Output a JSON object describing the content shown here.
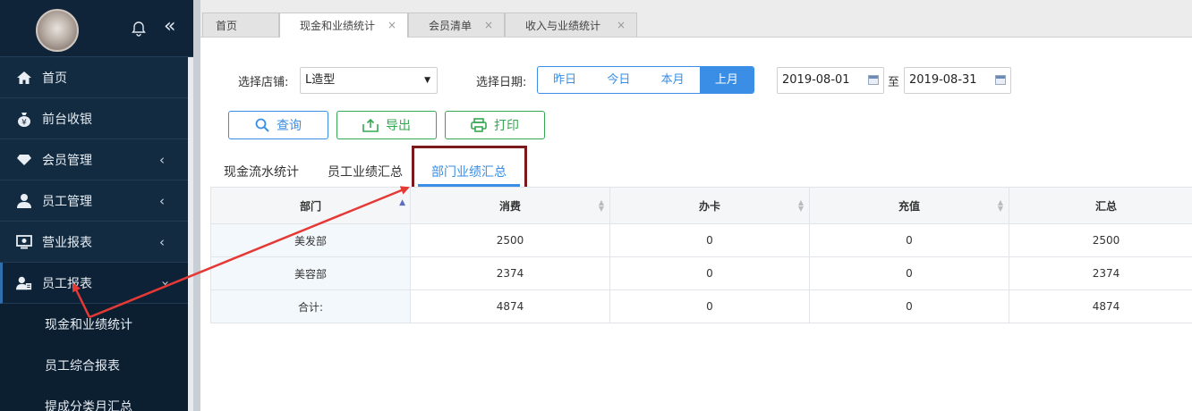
{
  "sidebar": {
    "menu": [
      {
        "label": "首页",
        "icon": "home-icon"
      },
      {
        "label": "前台收银",
        "icon": "money-bag-icon"
      },
      {
        "label": "会员管理",
        "icon": "diamond-icon"
      },
      {
        "label": "员工管理",
        "icon": "user-icon"
      },
      {
        "label": "营业报表",
        "icon": "monitor-icon"
      },
      {
        "label": "员工报表",
        "icon": "user-report-icon"
      }
    ],
    "submenu": [
      "现金和业绩统计",
      "员工综合报表",
      "提成分类月汇总"
    ]
  },
  "tabs": [
    {
      "label": "首页"
    },
    {
      "label": "现金和业绩统计",
      "close": "×"
    },
    {
      "label": "会员清单",
      "close": "×"
    },
    {
      "label": "收入与业绩统计",
      "close": "×"
    }
  ],
  "filters": {
    "store_label": "选择店铺:",
    "store_value": "L造型",
    "date_label": "选择日期:",
    "quick_dates": [
      "昨日",
      "今日",
      "本月",
      "上月"
    ],
    "selected_quick": "上月",
    "start_date": "2019-08-01",
    "to_label": "至",
    "end_date": "2019-08-31"
  },
  "actions": {
    "query": "查询",
    "export": "导出",
    "print": "打印"
  },
  "subtabs": [
    "现金流水统计",
    "员工业绩汇总",
    "部门业绩汇总"
  ],
  "table": {
    "headers": [
      "部门",
      "消费",
      "办卡",
      "充值",
      "汇总"
    ],
    "rows": [
      [
        "美发部",
        "2500",
        "0",
        "0",
        "2500"
      ],
      [
        "美容部",
        "2374",
        "0",
        "0",
        "2374"
      ],
      [
        "合计:",
        "4874",
        "0",
        "0",
        "4874"
      ]
    ]
  },
  "colors": {
    "accent": "#3a8ee6",
    "success": "#35a852",
    "sidebar": "#122b40",
    "annotation": "#e53935"
  }
}
